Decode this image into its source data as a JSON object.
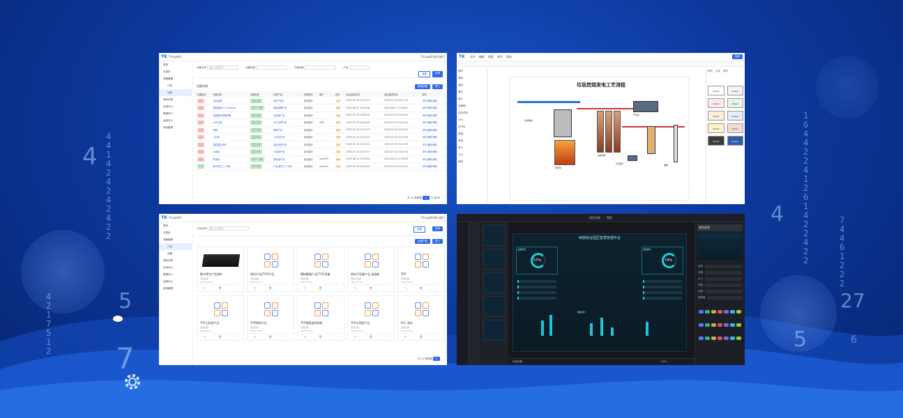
{
  "bg_digits": {
    "col_left": "4\n4\n1\n4\n2\n4\n2\n4\n2\n4\n2\n2",
    "col_right": "1\n6\n4\n4\n2\n2\n4\n1\n2\n6\n1\n4\n2\n2\n4\n2\n2",
    "col_right2": "7\n4\n4\n6\n1\n2\n2\n2",
    "col_bottom": "4\n2\n1\n7\n5\n1\n2",
    "big_left": "4",
    "big_right": "4",
    "big_27": "27",
    "big_5a": "5",
    "big_5b": "5",
    "big_7": "7",
    "big_6": "6"
  },
  "common": {
    "logo_short": "TK",
    "app_name": "ThingsKit",
    "user_label": "ThingsKit演示账户",
    "menu": [
      "首页",
      "可视化",
      "设备管理",
      "产品",
      "设备",
      "规则引擎",
      "应用中心",
      "数据中心",
      "运维中心",
      "系统管理"
    ]
  },
  "panel_devices": {
    "filter_labels": [
      "设备名称",
      "设备类型",
      "所属组织",
      "产品"
    ],
    "filter_placeholder": "请输入设备名称",
    "search_btn": "查询",
    "reset_btn": "重置",
    "list_title": "设备列表",
    "create_btn": "新增设备",
    "import_btn": "导入",
    "columns": [
      "",
      "设备图片",
      "设备名称",
      "设备类型",
      "所属产品",
      "所属组织",
      "客户",
      "状态",
      "最后连接时间",
      "最后离线时间",
      "操作"
    ],
    "rows": [
      [
        "",
        "离线",
        "测试设备",
        "直连设备",
        "测试产品A",
        "测试组织",
        "",
        "在线",
        "2023-07-18 14:07:27",
        "2023-07-18 15:17:20",
        "详情 编辑 删除"
      ],
      [
        "",
        "离线",
        "模拟数据-IoT Explorer",
        "网关子设备",
        "模拟数据产品",
        "测试组织",
        "",
        "离线",
        "2023-06-07 15:35:58",
        "2023-06-07 15:40:01",
        "详情 编辑 删除"
      ],
      [
        "",
        "离线",
        "温湿度传感器设备",
        "直连设备",
        "温湿度产品",
        "测试组织",
        "",
        "在线",
        "2023-07-18 14:08:00",
        "2023-07-18 14:21:00",
        "详情 编辑 删除"
      ],
      [
        "",
        "离线",
        "大厅空调",
        "直连设备",
        "大厅空调产品",
        "测试组织",
        "共享",
        "在线",
        "2023-07-19 10:00:00",
        "2023-07-19 10:21:00",
        "详情 编辑 删除"
      ],
      [
        "",
        "离线",
        "照明",
        "直连设备",
        "照明产品",
        "测试组织",
        "",
        "在线",
        "2023-07-14 14:13:13",
        "2023-07-18 14:21:00",
        "详情 编辑 删除"
      ],
      [
        "",
        "离线",
        "上料机",
        "直连设备",
        "上料机产品",
        "测试组织",
        "",
        "在线",
        "2023-07-14 14:13:13",
        "2023-07-18 14:21:00",
        "详情 编辑 删除"
      ],
      [
        "",
        "离线",
        "智能温控系统",
        "直连设备",
        "温控系统产品",
        "测试组织",
        "",
        "在线",
        "2023-07-14 14:13:13",
        "2023-07-18 14:21:00",
        "详情 编辑 删除"
      ],
      [
        "",
        "离线",
        "水培柜",
        "直连设备",
        "水培柜产品",
        "测试组织",
        "",
        "在线",
        "2023-07-14 14:13:13",
        "2023-07-18 14:21:00",
        "详情 编辑 删除"
      ],
      [
        "",
        "离线",
        "配电柜",
        "网关子设备",
        "配电柜产品",
        "测试组织",
        "yolo001",
        "离线",
        "2023-06-14 17:04:04",
        "2023-06-14 17:40:00",
        "详情 编辑 删除"
      ],
      [
        "",
        "在线",
        "数字孪生工厂网关",
        "网关设备",
        "产品-数字工厂网关",
        "测试组织",
        "yolo001",
        "在线",
        "2023-07-18 10:44:42",
        "2023-07-18 14:21:00",
        "详情 编辑 删除"
      ]
    ],
    "pager_total": "共 10 条数据",
    "pager_page": "1",
    "pager_size": "10 条/页"
  },
  "panel_flow": {
    "menu_items": [
      "文件",
      "编辑",
      "视图",
      "排列",
      "帮助"
    ],
    "title": "垃圾焚烧发电工艺流程",
    "side_labels": [
      "图形",
      "通用",
      "高级",
      "基本",
      "箭头",
      "流程图",
      "实体关系",
      "UML",
      "BPMN",
      "表格",
      "常规",
      "电气",
      "工业",
      "网络"
    ],
    "right_tabs": [
      "样式",
      "文本",
      "排列"
    ],
    "right_btn": "保存",
    "labels": [
      "垃圾储坑",
      "焚烧炉",
      "余热锅炉",
      "除尘器",
      "烟囱",
      "汽轮机",
      "发电机",
      "冷却塔",
      "飞灰固化"
    ],
    "color_card_labels": [
      "Shape",
      "Shape",
      "Shape",
      "Shape",
      "Shape",
      "Shape",
      "Shape",
      "Shape",
      "Shape",
      "Shape"
    ]
  },
  "panel_products": {
    "search_label": "产品名称",
    "search_placeholder": "请输入产品名称",
    "search_btn": "查询",
    "reset_btn": "重置",
    "create_btn": "创建产品",
    "import_btn": "导入",
    "cards": [
      {
        "name": "数字孪生产品组件",
        "s1": "直连设备",
        "s2": "2023-07-18"
      },
      {
        "name": "测试产品(TCP)产品",
        "s1": "直连设备",
        "s2": "2023-07-17"
      },
      {
        "name": "模拟数据产品(TCP)设备",
        "s1": "网关设备",
        "s2": "2023-07-14"
      },
      {
        "name": "网关子设备产品 温湿度",
        "s1": "网关子设备",
        "s2": "2023-07-14"
      },
      {
        "name": "TCP",
        "s1": "直连设备",
        "s2": "2023-07-13"
      },
      {
        "name": "TCP上料机产品",
        "s1": "直连设备",
        "s2": "2023-07-13"
      },
      {
        "name": "TCP照明产品",
        "s1": "直连设备",
        "s2": "2023-07-12"
      },
      {
        "name": "TCP智能温控系统",
        "s1": "直连设备",
        "s2": "2023-07-12"
      },
      {
        "name": "TCP水培柜产品",
        "s1": "直连设备",
        "s2": "2023-07-12"
      },
      {
        "name": "PLC 测试",
        "s1": "直连设备",
        "s2": "2023-07-11"
      }
    ],
    "pager_total": "共 23 条数据",
    "pager_page": "1"
  },
  "panel_dash": {
    "tabs": [
      "项目名称",
      "预览"
    ],
    "title": "西部综合园区智慧管理平台",
    "stat_left": "57%",
    "stat_right": "74%",
    "left_panel_title": "设备概况",
    "right_panel_title": "告警统计",
    "chart_title": "能耗统计",
    "right_header": "属性配置",
    "right_labels": [
      "名称",
      "位置",
      "大小",
      "背景",
      "边框",
      "透明度"
    ],
    "status": "页面设置",
    "zoom": "50%"
  }
}
